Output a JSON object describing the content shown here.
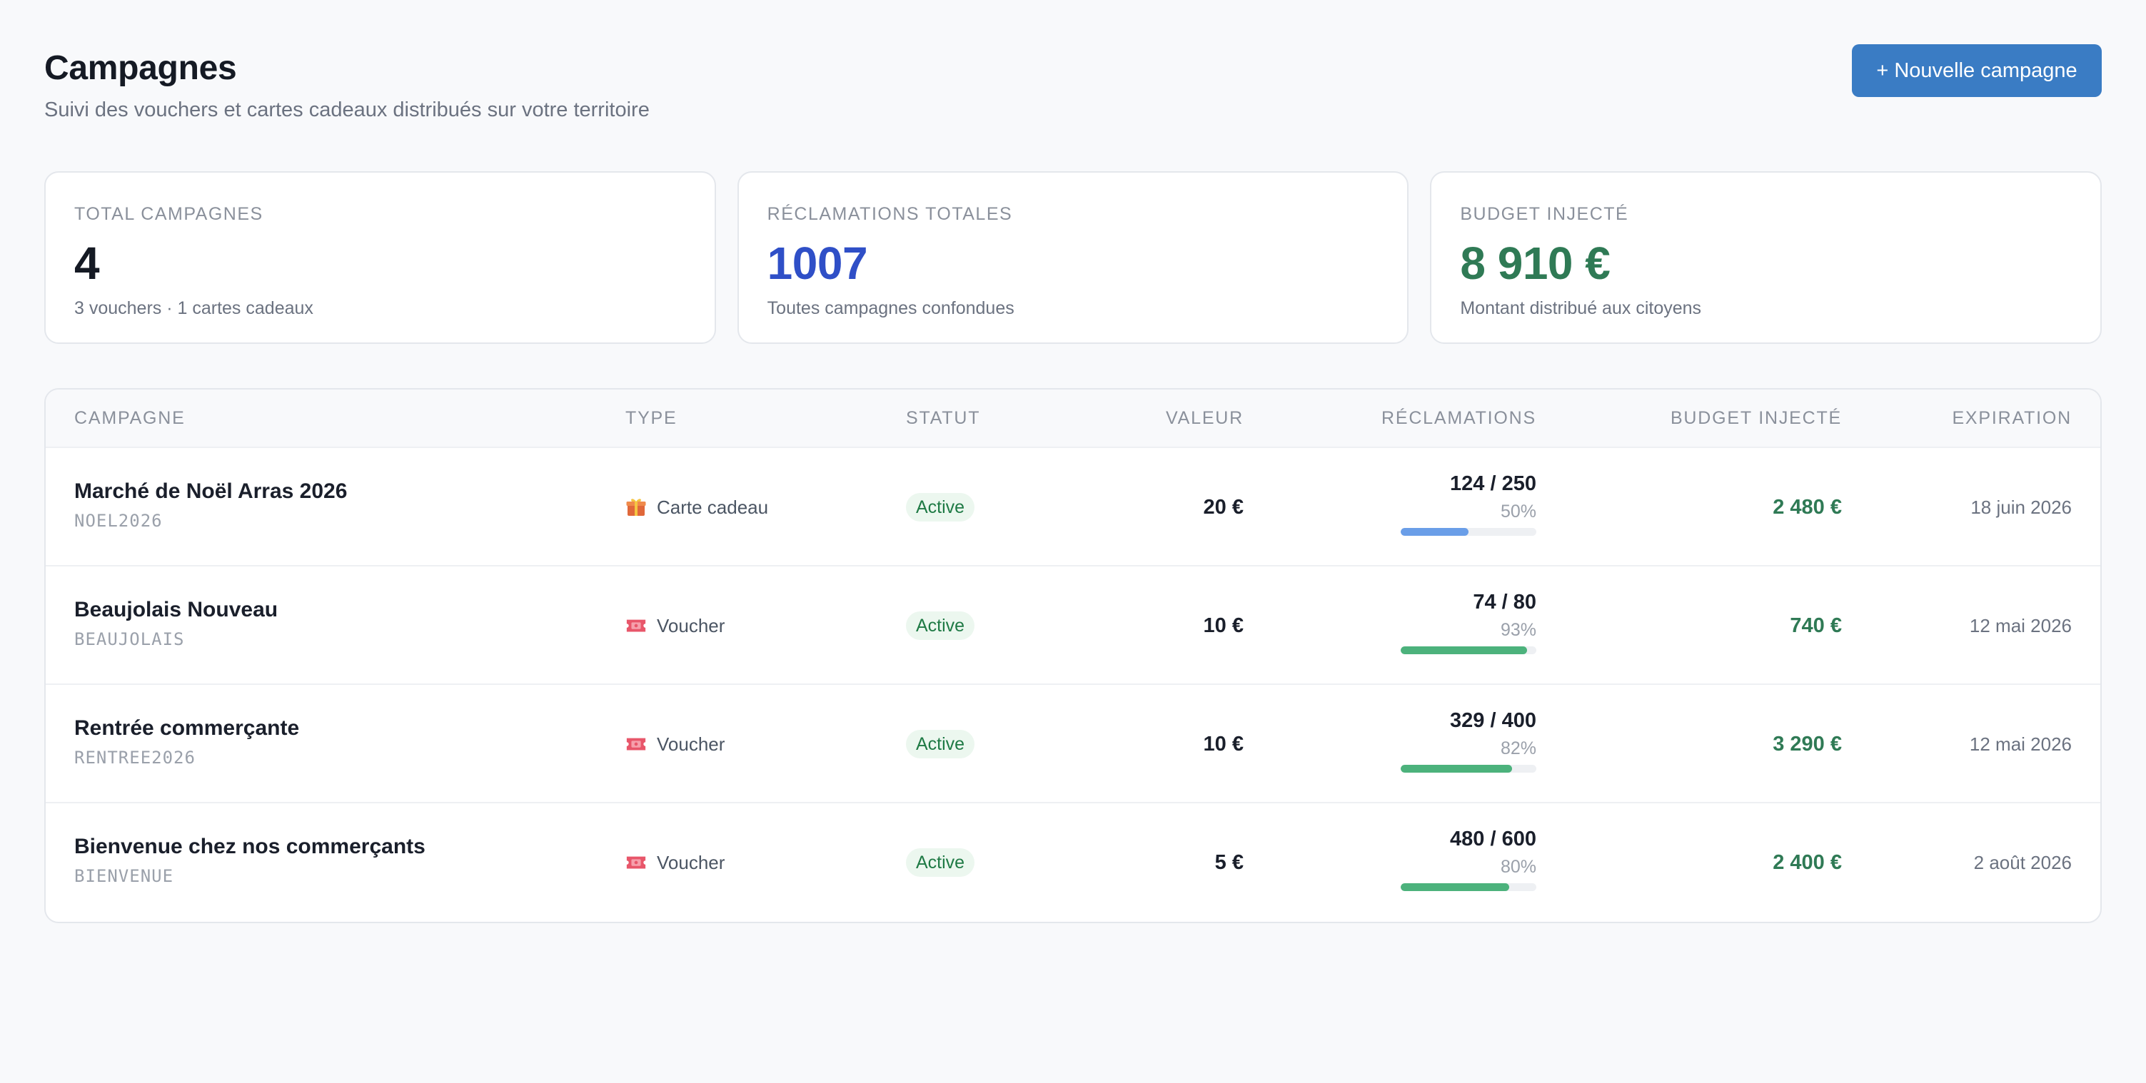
{
  "header": {
    "title": "Campagnes",
    "subtitle": "Suivi des vouchers et cartes cadeaux distribués sur votre territoire",
    "new_button_label": "+ Nouvelle campagne"
  },
  "stats": [
    {
      "label": "TOTAL CAMPAGNES",
      "value": "4",
      "note": "3 vouchers · 1 cartes cadeaux",
      "color": "#151a24"
    },
    {
      "label": "RÉCLAMATIONS TOTALES",
      "value": "1007",
      "note": "Toutes campagnes confondues",
      "color": "#2f4fc7"
    },
    {
      "label": "BUDGET INJECTÉ",
      "value": "8 910 €",
      "note": "Montant distribué aux citoyens",
      "color": "#2f7a55"
    }
  ],
  "table": {
    "columns": {
      "campagne": "CAMPAGNE",
      "type": "TYPE",
      "statut": "STATUT",
      "valeur": "VALEUR",
      "reclamations": "RÉCLAMATIONS",
      "budget": "BUDGET INJECTÉ",
      "expiration": "EXPIRATION"
    },
    "rows": [
      {
        "name": "Marché de Noël Arras 2026",
        "code": "NOEL2026",
        "type": "Carte cadeau",
        "type_icon": "gift-icon",
        "status": "Active",
        "value": "20 €",
        "claims": "124 / 250",
        "pct_label": "50%",
        "pct": 0.5,
        "bar_color": "#6a9ee8",
        "budget": "2 480 €",
        "expiration": "18 juin 2026"
      },
      {
        "name": "Beaujolais Nouveau",
        "code": "BEAUJOLAIS",
        "type": "Voucher",
        "type_icon": "ticket-icon",
        "status": "Active",
        "value": "10 €",
        "claims": "74 / 80",
        "pct_label": "93%",
        "pct": 0.93,
        "bar_color": "#4cb27c",
        "budget": "740 €",
        "expiration": "12 mai 2026"
      },
      {
        "name": "Rentrée commerçante",
        "code": "RENTREE2026",
        "type": "Voucher",
        "type_icon": "ticket-icon",
        "status": "Active",
        "value": "10 €",
        "claims": "329 / 400",
        "pct_label": "82%",
        "pct": 0.82,
        "bar_color": "#4cb27c",
        "budget": "3 290 €",
        "expiration": "12 mai 2026"
      },
      {
        "name": "Bienvenue chez nos commerçants",
        "code": "BIENVENUE",
        "type": "Voucher",
        "type_icon": "ticket-icon",
        "status": "Active",
        "value": "5 €",
        "claims": "480 / 600",
        "pct_label": "80%",
        "pct": 0.8,
        "bar_color": "#4cb27c",
        "budget": "2 400 €",
        "expiration": "2 août 2026"
      }
    ]
  }
}
